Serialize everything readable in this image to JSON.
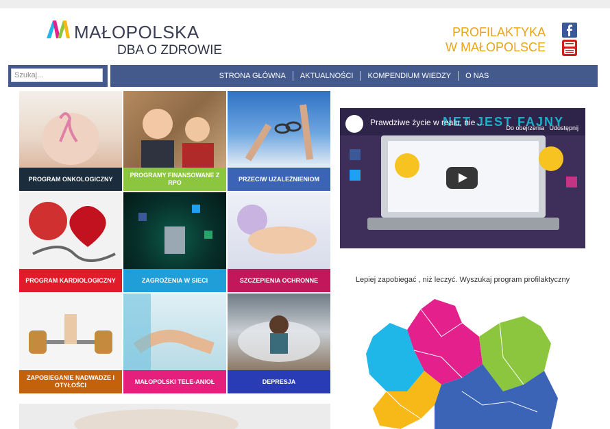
{
  "header": {
    "logo_name": "MAŁOPOLSKA",
    "logo_tagline": "DBA O ZDROWIE",
    "right_title_line1": "PROFILAKTYKA",
    "right_title_line2": "W MAŁOPOLSCE",
    "social": [
      "facebook-icon",
      "youtube-icon"
    ]
  },
  "search": {
    "placeholder": "Szukaj..."
  },
  "nav": {
    "items": [
      "STRONA GŁÓWNA",
      "AKTUALNOŚCI",
      "KOMPENDIUM WIEDZY",
      "O NAS"
    ]
  },
  "tiles": [
    {
      "label": "PROGRAM ONKOLOGICZNY",
      "color": "#1b2c3c"
    },
    {
      "label": "PROGRAMY FINANSOWANE Z RPO",
      "color": "#8cc63e"
    },
    {
      "label": "PRZECIW UZALEŻNIENIOM",
      "color": "#3b64b6"
    },
    {
      "label": "PROGRAM KARDIOLOGICZNY",
      "color": "#e21b2a"
    },
    {
      "label": "ZAGROŻENIA W SIECI",
      "color": "#1f9ed8"
    },
    {
      "label": "SZCZEPIENIA OCHRONNE",
      "color": "#c2185b"
    },
    {
      "label": "ZAPOBIEGANIE NADWADZE I OTYŁOŚCI",
      "color": "#c4620c"
    },
    {
      "label": "MAŁOPOLSKI TELE-ANIOŁ",
      "color": "#e4207c"
    },
    {
      "label": "DEPRESJA",
      "color": "#2a3bb6"
    }
  ],
  "video": {
    "title": "Prawdziwe życie w realu, nie ...",
    "overlay_text": "NET JEST FAJNY",
    "watch_later": "Do obejrzenia",
    "share": "Udostępnij"
  },
  "find_program_text": "Lepiej zapobiegać , niż leczyć. Wyszukaj program profilaktyczny",
  "colors": {
    "nav_bg": "#445a8c",
    "accent_orange": "#e8a317",
    "map_magenta": "#e4208c",
    "map_blue": "#3b64b6",
    "map_green": "#8cc63e",
    "map_cyan": "#1fb7e8",
    "map_yellow": "#f7b917"
  }
}
